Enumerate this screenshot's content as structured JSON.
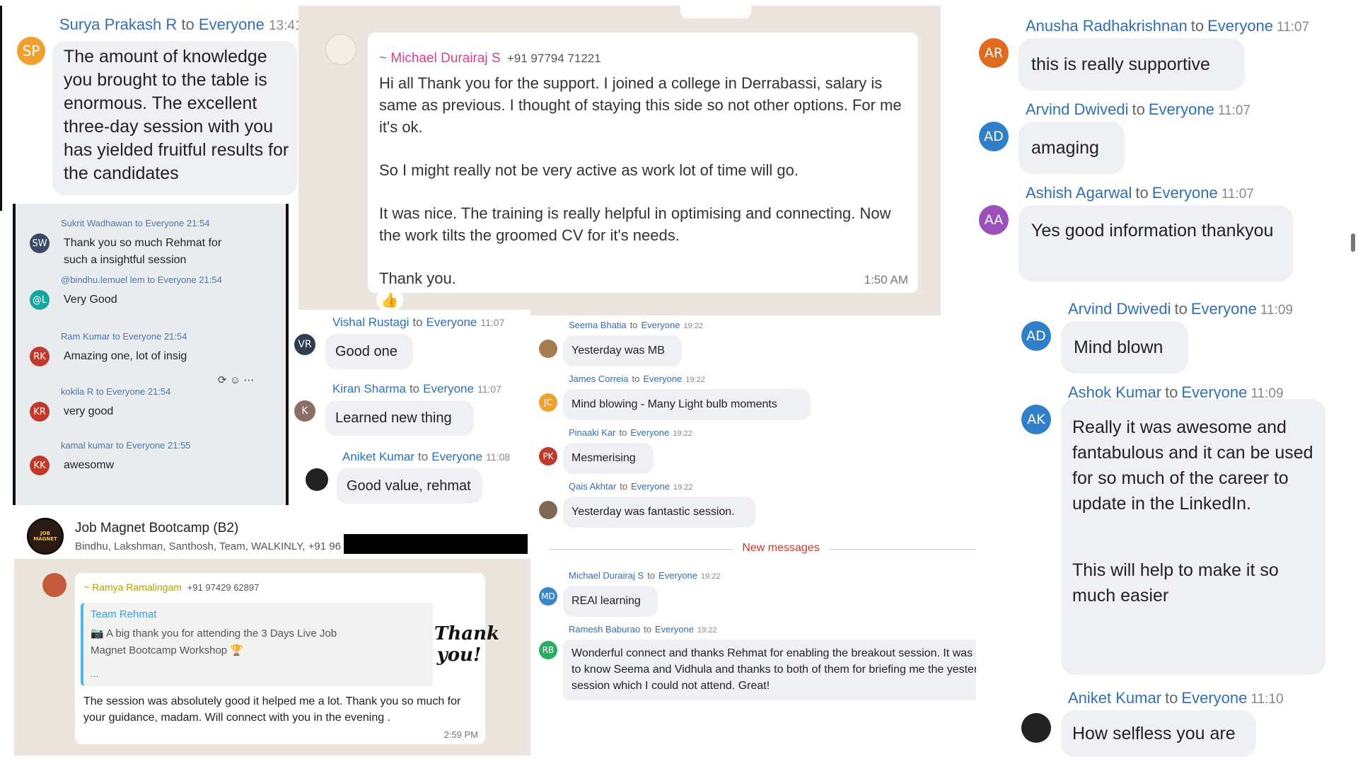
{
  "top_left": {
    "avatar": {
      "initials": "SP",
      "color": "#f2a02d"
    },
    "sender": "Surya Prakash R",
    "to": "to",
    "recipient": "Everyone",
    "time": "13:41",
    "text": "The amount of knowledge you brought to the table is enormous. The excellent three-day session with you has yielded fruitful results for the candidates"
  },
  "whatsapp_michael": {
    "sender": "~ Michael Durairaj S",
    "phone": "+91 97794 71221",
    "p1": "Hi all Thank you for the support. I joined a college in Derrabassi, salary is same as previous. I thought of staying this side so not other options. For me it's ok.",
    "p2": "So I might really not be very active as work lot of time will go.",
    "p3": "It was nice. The training is really helpful in optimising and connecting. Now the work tilts the groomed CV for it's needs.",
    "p4": "Thank you.",
    "time": "1:50 AM",
    "reaction": "👍"
  },
  "phone_photo": {
    "messages": [
      {
        "initials": "SW",
        "color": "#3a4a66",
        "meta": "Sukrit Wadhawan to Everyone 21:54",
        "text": "Thank you so much Rehmat for such a insightful session"
      },
      {
        "initials": "@L",
        "color": "#16a6a0",
        "meta": "@bindhu.lemuel lem to Everyone 21:54",
        "text": "Very Good"
      },
      {
        "initials": "RK",
        "color": "#c0392b",
        "meta": "Ram Kumar to Everyone 21:54",
        "text": "Amazing one, lot of insig"
      },
      {
        "initials": "KR",
        "color": "#c0392b",
        "meta": "kokila R to Everyone 21:54",
        "text": "very good"
      },
      {
        "initials": "KK",
        "color": "#c0392b",
        "meta": "kamal kumar to Everyone 21:55",
        "text": "awesomw"
      }
    ],
    "actions": "⟳ ☺ ⋯"
  },
  "middle_chat": {
    "messages": [
      {
        "initials": "VR",
        "color": "#2f3e50",
        "sender": "Vishal Rustagi",
        "to": "to",
        "recipient": "Everyone",
        "time": "11:07",
        "text": "Good one"
      },
      {
        "initials": "K",
        "color": "#8d6e63",
        "sender": "Kiran Sharma",
        "to": "to",
        "recipient": "Everyone",
        "time": "11:07",
        "text": "Learned new thing"
      },
      {
        "initials": "",
        "color": "#222",
        "sender": "Aniket Kumar",
        "to": "to",
        "recipient": "Everyone",
        "time": "11:08",
        "text": "Good value, rehmat"
      }
    ]
  },
  "group_header": {
    "title": "Job Magnet Bootcamp (B2)",
    "members": "Bindhu, Lakshman, Santhosh, Team, WALKINLY, +91 96",
    "logo_text": "JOB MAGNET"
  },
  "whatsapp_ramya": {
    "sender": "~ Ramya Ramalingam",
    "phone": "+91 97429 62897",
    "quote_author": "Team Rehmat",
    "quote_text": "📷 A big thank you for attending the 3 Days Live Job Magnet Bootcamp Workshop 🏆",
    "quote_more": "...",
    "thumb_text": "Thank you!",
    "text": "The session was absolutely good it helped me a lot.  Thank you so much for your guidance, madam. Will connect with you in the evening .",
    "time": "2:59 PM"
  },
  "center_chat": {
    "messages": [
      {
        "initials": "",
        "color": "#a67c52",
        "sender": "Seema Bhatia",
        "to": "to",
        "recipient": "Everyone",
        "time": "19:22",
        "text": "Yesterday was MB"
      },
      {
        "initials": "JC",
        "color": "#f2a02d",
        "sender": "James Correia",
        "to": "to",
        "recipient": "Everyone",
        "time": "19:22",
        "text": "Mind blowing - Many Light bulb moments"
      },
      {
        "initials": "PK",
        "color": "#c0392b",
        "sender": "Pinaaki Kar",
        "to": "to",
        "recipient": "Everyone",
        "time": "19:22",
        "text": "Mesmerising"
      },
      {
        "initials": "",
        "color": "#7d6a55",
        "sender": "Qais Akhtar",
        "to": "to",
        "recipient": "Everyone",
        "time": "19:22",
        "text": "Yesterday was fantastic session."
      }
    ],
    "divider": "New messages",
    "messages2": [
      {
        "initials": "MD",
        "color": "#3a86c8",
        "sender": "Michael Durairaj S",
        "to": "to",
        "recipient": "Everyone",
        "time": "19:22",
        "text": "REAl learning"
      },
      {
        "initials": "RB",
        "color": "#27ae60",
        "sender": "Ramesh Baburao",
        "to": "to",
        "recipient": "Everyone",
        "time": "19:22",
        "text": "Wonderful connect and thanks Rehmat for enabling the breakout session. It was great to know Seema and Vidhula and thanks to both of them for briefing me the yesterday's session which I could not attend. Great!"
      }
    ]
  },
  "right_chat": {
    "messages": [
      {
        "initials": "AR",
        "color": "#e06a1f",
        "sender": "Anusha Radhakrishnan",
        "to": "to",
        "recipient": "Everyone",
        "time": "11:07",
        "text": "this is really supportive"
      },
      {
        "initials": "AD",
        "color": "#2f80c8",
        "sender": "Arvind Dwivedi",
        "to": "to",
        "recipient": "Everyone",
        "time": "11:07",
        "text": "amaging"
      },
      {
        "initials": "AA",
        "color": "#9b4fb8",
        "sender": "Ashish Agarwal",
        "to": "to",
        "recipient": "Everyone",
        "time": "11:07",
        "text": "Yes good information thankyou"
      },
      {
        "initials": "AD",
        "color": "#2f80c8",
        "sender": "Arvind Dwivedi",
        "to": "to",
        "recipient": "Everyone",
        "time": "11:09",
        "text": "Mind blown"
      },
      {
        "initials": "AK",
        "color": "#2f80c8",
        "sender": "Ashok Kumar",
        "to": "to",
        "recipient": "Everyone",
        "time": "11:09",
        "text": "Really it was awesome and fantabulous and it can be used for so much of the career to update in the LinkedIn.",
        "text2": "This will help to make it so much easier"
      },
      {
        "initials": "",
        "color": "#222",
        "sender": "Aniket Kumar",
        "to": "to",
        "recipient": "Everyone",
        "time": "11:10",
        "text": "How selfless you are"
      }
    ]
  }
}
